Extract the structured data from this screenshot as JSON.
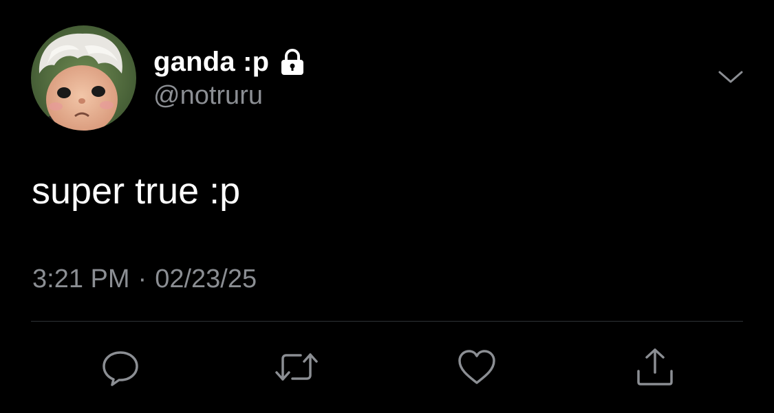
{
  "user": {
    "display_name": "ganda :p",
    "handle": "@notruru",
    "protected": true,
    "avatar": "avatar-image"
  },
  "tweet": {
    "text": "super true :p",
    "time": "3:21 PM",
    "separator": "·",
    "date": "02/23/25"
  },
  "icons": {
    "lock": "lock-icon",
    "more": "chevron-down-icon",
    "reply": "reply-icon",
    "retweet": "retweet-icon",
    "like": "heart-icon",
    "share": "share-icon"
  },
  "colors": {
    "background": "#000000",
    "primary_text": "#ffffff",
    "secondary_text": "#8b8e93",
    "icon": "#8b8e93",
    "divider": "#2f3336"
  }
}
